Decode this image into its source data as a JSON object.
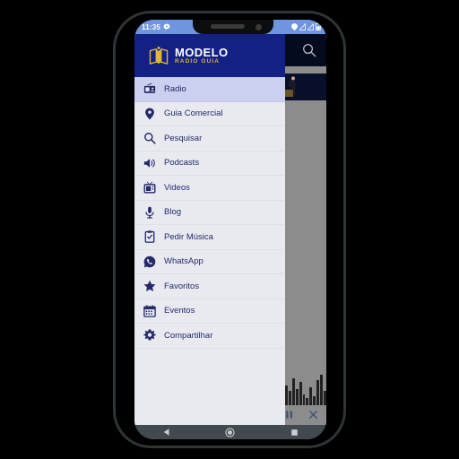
{
  "device": {
    "frame_color": "#2f3437",
    "screen_bg": "#e9eaf0"
  },
  "status_bar": {
    "time": "11:35",
    "bg_color": "#6f94e0",
    "icons": [
      {
        "name": "chat-bubble-icon"
      },
      {
        "name": "location-icon"
      },
      {
        "name": "signal-icon-1"
      },
      {
        "name": "signal-icon-2"
      },
      {
        "name": "battery-icon"
      }
    ]
  },
  "app": {
    "toolbar": {
      "bg_color": "#050b1e",
      "search_icon": "search-icon"
    },
    "player": {
      "pause_label": "‖",
      "close_label": "✕",
      "bg_color": "#8c8c8c",
      "control_color": "#43567a"
    },
    "equalizer": {
      "bars": [
        14,
        22,
        16,
        30,
        18,
        26,
        12,
        8,
        20,
        10,
        28,
        34,
        16
      ]
    }
  },
  "drawer": {
    "header": {
      "bg_color": "#122183",
      "logo_icon": "book-logo-icon",
      "title": "MODELO",
      "subtitle": "RADIO GUIA",
      "title_color": "#ffffff",
      "subtitle_color": "#e0b63b"
    },
    "active_index": 0,
    "highlight_color": "#ccd0f0",
    "text_color": "#23296b",
    "items": [
      {
        "label": "Radio",
        "icon": "radio-icon"
      },
      {
        "label": "Guia Comercial",
        "icon": "location-pin-icon"
      },
      {
        "label": "Pesquisar",
        "icon": "search-icon"
      },
      {
        "label": "Podcasts",
        "icon": "speaker-icon"
      },
      {
        "label": "Videos",
        "icon": "tv-icon"
      },
      {
        "label": "Blog",
        "icon": "microphone-icon"
      },
      {
        "label": "Pedir Música",
        "icon": "clipboard-icon"
      },
      {
        "label": "WhatsApp",
        "icon": "whatsapp-icon"
      },
      {
        "label": "Favoritos",
        "icon": "star-icon"
      },
      {
        "label": "Eventos",
        "icon": "calendar-icon"
      },
      {
        "label": "Compartilhar",
        "icon": "gear-icon"
      }
    ]
  },
  "nav_bar": {
    "bg_color": "#414a4f",
    "buttons": [
      {
        "name": "back-button",
        "icon": "triangle-left-icon"
      },
      {
        "name": "home-button",
        "icon": "circle-icon"
      },
      {
        "name": "recents-button",
        "icon": "square-icon"
      }
    ]
  }
}
